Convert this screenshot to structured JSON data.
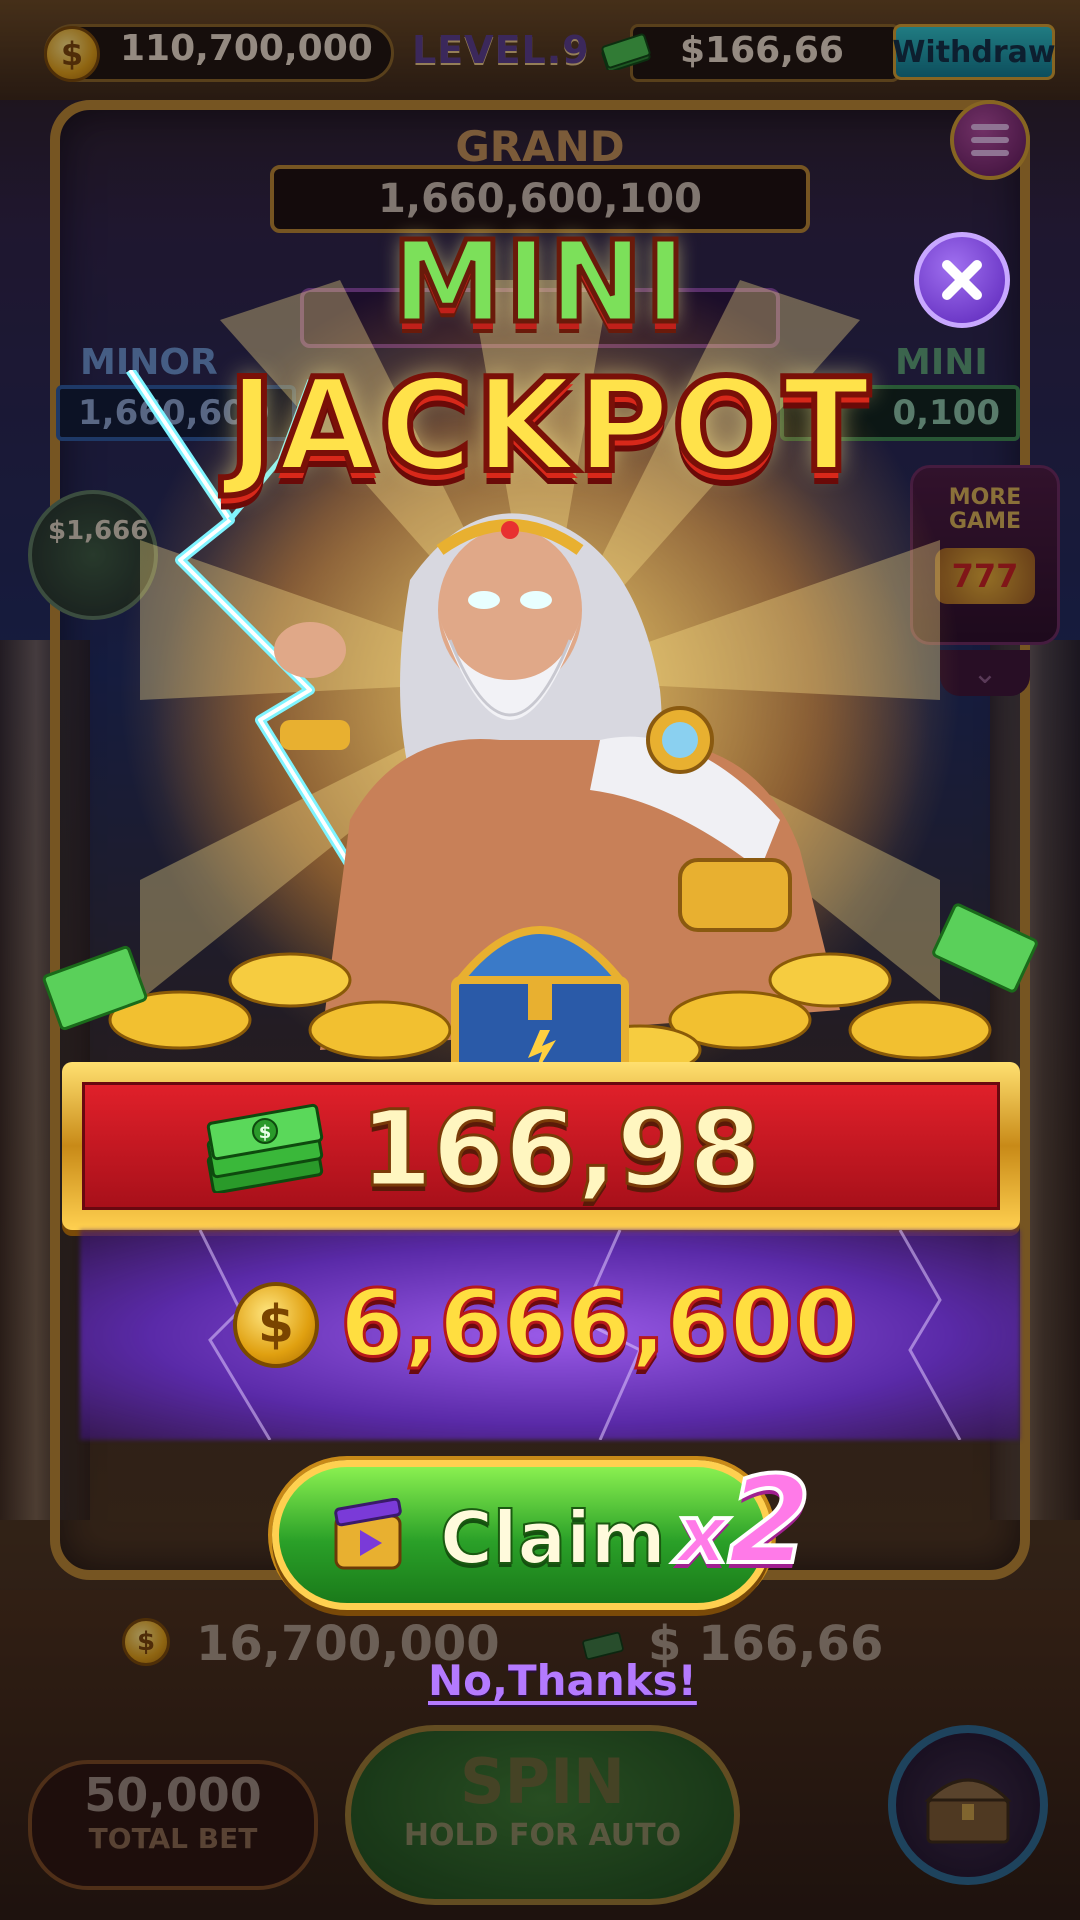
{
  "topbar": {
    "coins": "110,700,000",
    "level": "LEVEL.9",
    "cash": "$166,66",
    "withdraw_label": "Withdraw"
  },
  "jackpots": {
    "grand_label": "GRAND",
    "grand_value": "1,660,600,100",
    "minor_label": "MINOR",
    "minor_value": "1,660,600",
    "mini_label": "MINI",
    "mini_value": "0,100"
  },
  "side": {
    "bubble_label": "$1,666",
    "more_game_label": "MORE GAME",
    "more_game_badge": "777"
  },
  "popup": {
    "title_line1": "MINI",
    "title_line2": "JACKPOT",
    "cash_reward": "166,98",
    "coin_reward": "6,666,600",
    "claim_label": "Claim",
    "multiplier_x": "x",
    "multiplier_value": "2",
    "decline_label": "No,Thanks!"
  },
  "bottom": {
    "balance_coins": "16,700,000",
    "balance_cash": "$ 166,66",
    "total_bet_value": "50,000",
    "total_bet_label": "TOTAL BET",
    "spin_label": "SPIN",
    "spin_sub": "HOLD FOR AUTO"
  },
  "icons": {
    "coin": "coin-icon",
    "cash": "cash-stack-icon",
    "close": "close-icon",
    "menu": "hamburger-menu-icon",
    "video": "video-ad-icon",
    "chest": "treasure-chest-icon"
  },
  "colors": {
    "accent_gold": "#d4a02a",
    "claim_green": "#2aa028",
    "cash_red": "#c8141e",
    "popup_purple": "#7a3ad8",
    "decline_purple": "#b47aff"
  }
}
